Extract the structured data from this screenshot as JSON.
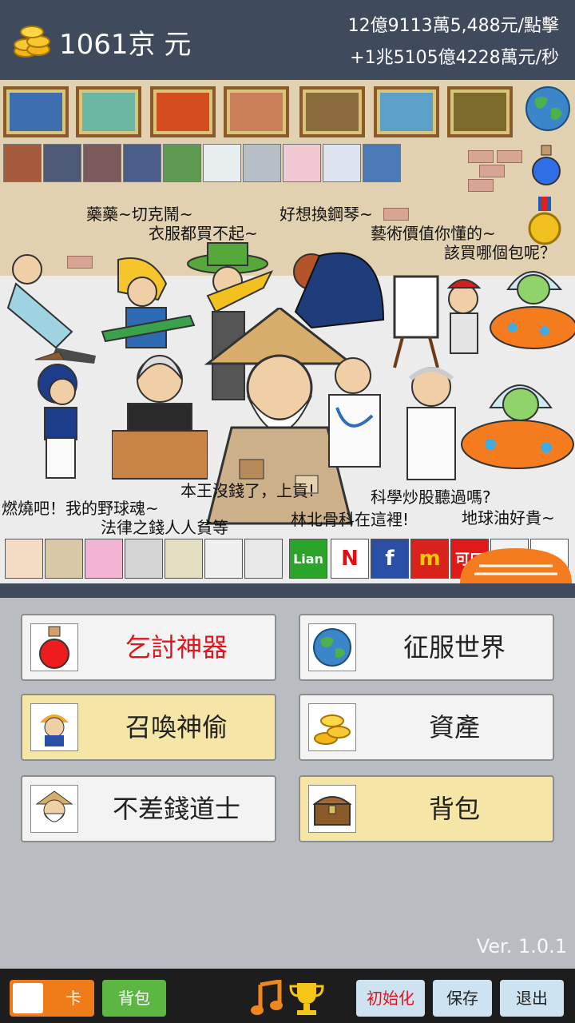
{
  "header": {
    "money": "1061京 元",
    "per_tap": "12億9113萬5,488元/點擊",
    "per_sec": "+1兆5105億4228萬元/秒"
  },
  "scene": {
    "speech": [
      "藥藥~切克鬧~",
      "衣服都買不起~",
      "好想換鋼琴~",
      "藝術價值你懂的~",
      "該買哪個包呢？",
      "燃燒吧！我的野球魂~",
      "法律之錢人人貧等",
      "本王沒錢了，上貢!",
      "科學炒股聽過嗎?",
      "林北骨科在這裡!",
      "地球油好貴~"
    ],
    "shops": [
      "Lian",
      "N",
      "f",
      "m",
      "可口"
    ]
  },
  "menu": {
    "beggar_artifact": "乞討神器",
    "conquer_world": "征服世界",
    "summon_thief": "召喚神偷",
    "assets": "資產",
    "rich_taoist": "不差錢道士",
    "backpack": "背包"
  },
  "version": "Ver. 1.0.1",
  "footer": {
    "card": "卡",
    "bag": "背包",
    "reset": "初始化",
    "save": "保存",
    "exit": "退出"
  },
  "colors": {
    "header_bg": "#3f4a5c",
    "beggar_red": "#e0161d",
    "card_orange": "#ef7c18",
    "bag_green": "#5cb642",
    "btn_yellow": "#f5e6a7"
  }
}
